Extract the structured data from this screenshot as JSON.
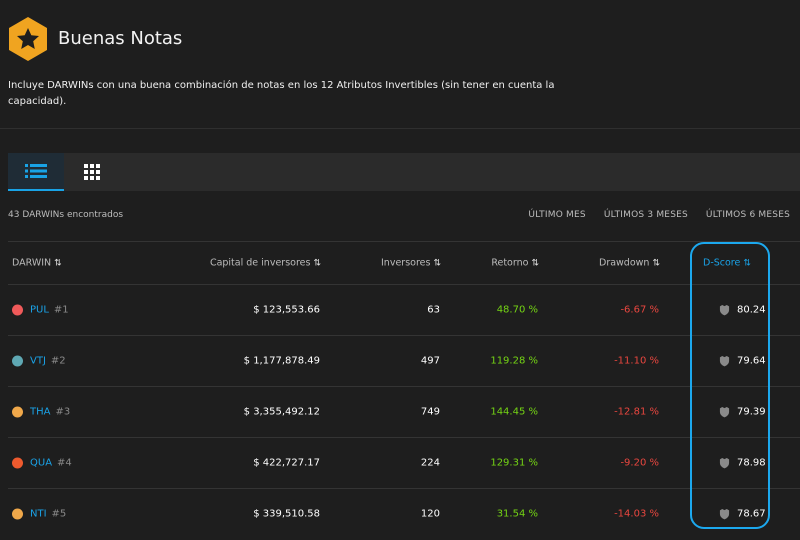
{
  "page": {
    "title": "Buenas Notas",
    "description": "Incluye DARWINs con una buena combinación de notas en los 12 Atributos Invertibles (sin tener en cuenta la capacidad)."
  },
  "results": {
    "count_text": "43 DARWINs encontrados",
    "filters": [
      "ÚLTIMO MES",
      "ÚLTIMOS 3 MESES",
      "ÚLTIMOS 6 MESES"
    ]
  },
  "table": {
    "columns": {
      "darwin": "DARWIN",
      "capital": "Capital de inversores",
      "investors": "Inversores",
      "return": "Retorno",
      "drawdown": "Drawdown",
      "dscore": "D-Score"
    },
    "sort_icon": "⇅",
    "rows": [
      {
        "ticker": "PUL",
        "rank": "#1",
        "capital": "$ 123,553.66",
        "investors": "63",
        "return": "48.70 %",
        "drawdown": "-6.67 %",
        "dscore": "80.24",
        "color": "#f05a5a"
      },
      {
        "ticker": "VTJ",
        "rank": "#2",
        "capital": "$ 1,177,878.49",
        "investors": "497",
        "return": "119.28 %",
        "drawdown": "-11.10 %",
        "dscore": "79.64",
        "color": "#5fa8b3"
      },
      {
        "ticker": "THA",
        "rank": "#3",
        "capital": "$ 3,355,492.12",
        "investors": "749",
        "return": "144.45 %",
        "drawdown": "-12.81 %",
        "dscore": "79.39",
        "color": "#f0a84a"
      },
      {
        "ticker": "QUA",
        "rank": "#4",
        "capital": "$ 422,727.17",
        "investors": "224",
        "return": "129.31 %",
        "drawdown": "-9.20 %",
        "dscore": "78.98",
        "color": "#ee5a2e"
      },
      {
        "ticker": "NTI",
        "rank": "#5",
        "capital": "$ 339,510.58",
        "investors": "120",
        "return": "31.54 %",
        "drawdown": "-14.03 %",
        "dscore": "78.67",
        "color": "#f0a84a"
      }
    ]
  },
  "colors": {
    "accent": "#1aa3e8",
    "positive": "#74d414",
    "negative": "#e8463f",
    "badge": "#f0a420"
  },
  "icons": {
    "badge": "star-hexagon-icon",
    "list_view": "list-icon",
    "grid_view": "grid-icon",
    "dscore": "shield-icon"
  }
}
